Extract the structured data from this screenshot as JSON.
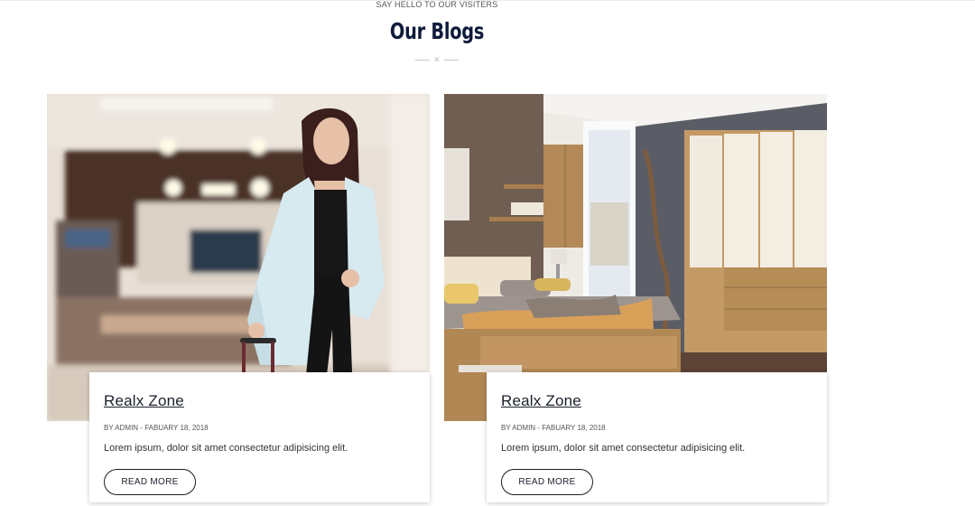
{
  "section": {
    "eyebrow": "SAY HELLO TO OUR VISITERS",
    "title": "Our Blogs",
    "divider_icon": "x-icon"
  },
  "posts": [
    {
      "image": "businesswoman-with-suitcase-hotel-lobby-photo",
      "title": "Realx Zone",
      "meta": "BY ADMIN - FABUARY 18, 2018",
      "excerpt": "Lorem ipsum, dolor sit amet consectetur adipisicing elit.",
      "button_label": "READ MORE"
    },
    {
      "image": "bedroom-with-wooden-bed-and-wardrobe-photo",
      "title": "Realx Zone",
      "meta": "BY ADMIN - FABUARY 18, 2018",
      "excerpt": "Lorem ipsum, dolor sit amet consectetur adipisicing elit.",
      "button_label": "READ MORE"
    }
  ]
}
